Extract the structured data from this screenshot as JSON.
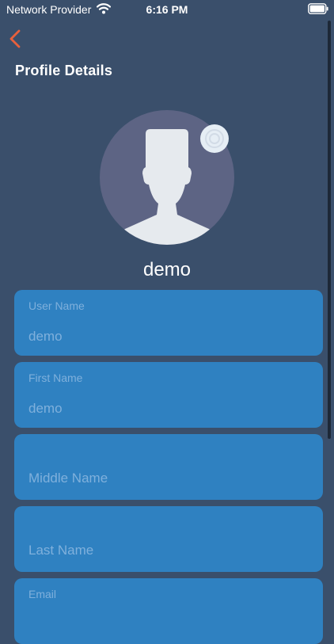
{
  "status_bar": {
    "carrier": "Network Provider",
    "time": "6:16 PM",
    "wifi_icon": "wifi-icon",
    "battery_icon": "battery-icon"
  },
  "header": {
    "back_icon": "chevron-left-icon",
    "back_color": "#e8603c",
    "title": "Profile Details"
  },
  "profile": {
    "avatar_icon": "person-silhouette-icon",
    "camera_icon": "camera-icon",
    "display_name": "demo"
  },
  "form": {
    "user_name": {
      "label": "User Name",
      "value": "demo"
    },
    "first_name": {
      "label": "First Name",
      "value": "demo"
    },
    "middle_name": {
      "placeholder": "Middle Name"
    },
    "last_name": {
      "placeholder": "Last Name"
    },
    "email": {
      "label": "Email"
    }
  },
  "colors": {
    "background": "#3a4f6b",
    "field_background": "#2f81c1",
    "field_text": "#7fb0dc",
    "accent": "#e8603c"
  }
}
